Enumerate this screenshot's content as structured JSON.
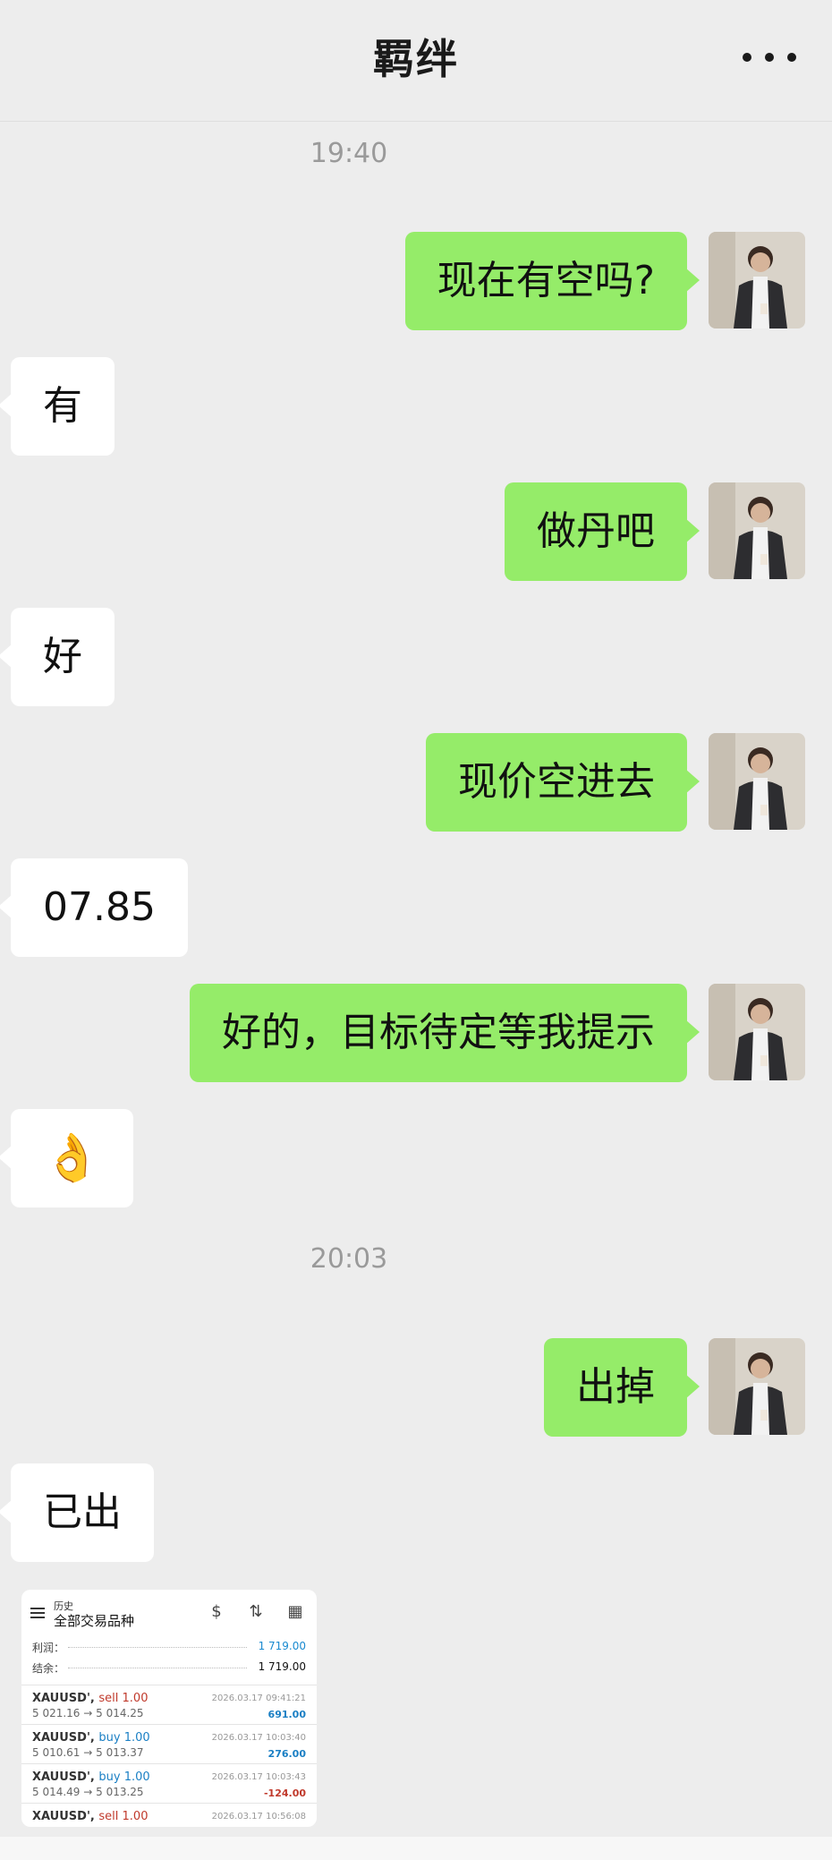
{
  "header": {
    "title": "羁绊",
    "more_icon": "more-dots-icon"
  },
  "timestamps": [
    "19:40",
    "20:03"
  ],
  "messages": [
    {
      "from": "me",
      "text": "现在有空吗?"
    },
    {
      "from": "other",
      "text": "有"
    },
    {
      "from": "me",
      "text": "做丹吧"
    },
    {
      "from": "other",
      "text": "好"
    },
    {
      "from": "me",
      "text": "现价空进去"
    },
    {
      "from": "other",
      "text": "07.85"
    },
    {
      "from": "me",
      "text": "好的，目标待定等我提示"
    },
    {
      "from": "other",
      "text": "👌"
    },
    {
      "from": "me",
      "text": "出掉"
    },
    {
      "from": "other",
      "text": "已出"
    }
  ],
  "screenshot": {
    "sub": "历史",
    "title": "全部交易品种",
    "profit_label": "利润：",
    "profit_value": "1 719.00",
    "balance_label": "结余：",
    "balance_value": "1 719.00",
    "trades": [
      {
        "symbol": "XAUUSD',",
        "direction": "sell 1.00",
        "prices": "5 021.16 → 5 014.25",
        "datetime": "2026.03.17 09:41:21",
        "pl": "691.00"
      },
      {
        "symbol": "XAUUSD',",
        "direction": "buy 1.00",
        "prices": "5 010.61 → 5 013.37",
        "datetime": "2026.03.17 10:03:40",
        "pl": "276.00"
      },
      {
        "symbol": "XAUUSD',",
        "direction": "buy 1.00",
        "prices": "5 014.49 → 5 013.25",
        "datetime": "2026.03.17 10:03:43",
        "pl": "-124.00"
      },
      {
        "symbol": "XAUUSD',",
        "direction": "sell 1.00",
        "prices": "",
        "datetime": "2026.03.17 10:56:08",
        "pl": ""
      }
    ]
  },
  "colors": {
    "my_bubble": "#95ec69",
    "other_bubble": "#ffffff",
    "background": "#ededed"
  }
}
